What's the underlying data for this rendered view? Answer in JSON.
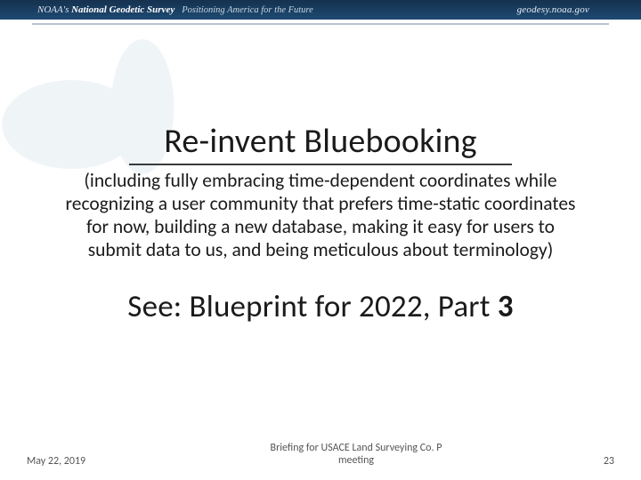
{
  "banner": {
    "brand_light": "NOAA's ",
    "brand_bold": "National Geodetic Survey",
    "tagline": " Positioning America for the Future",
    "url": "geodesy.noaa.gov"
  },
  "slide": {
    "title": "Re-invent Bluebooking",
    "subtitle": "(including fully embracing time-dependent coordinates while recognizing a user community that prefers time-static coordinates for now, building a new database, making it easy for users to submit data to us, and being meticulous about terminology)",
    "see_prefix": "See:  Blueprint for 2022, Part ",
    "see_partnum": "3"
  },
  "footer": {
    "date": "May 22, 2019",
    "mid_line1": "Briefing for USACE Land Surveying Co. P",
    "mid_line2": "meeting",
    "page": "23"
  }
}
